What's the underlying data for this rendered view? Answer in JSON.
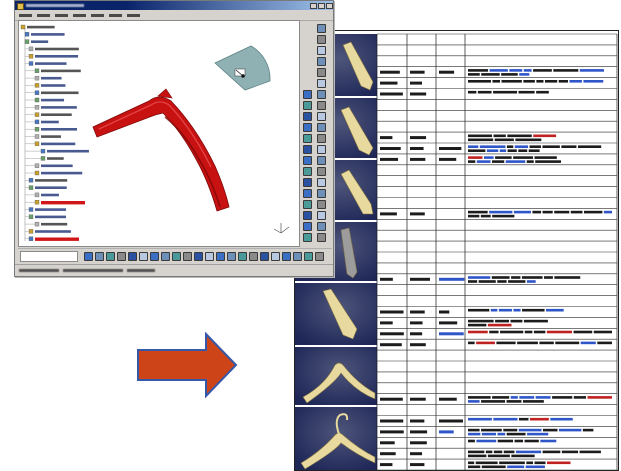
{
  "colors": {
    "arrow_fill": "#cc4418",
    "arrow_border": "#3658a8",
    "model_red": "#c81212",
    "model_red_dark": "#7e0808",
    "compass_teal": "#8fb1b3",
    "part_beige": "#e8da9e",
    "part_gray": "#9c9c9c",
    "thumb_bg": "#1d2656",
    "title_bar": "#0a246a",
    "window_face": "#d6d3ce"
  },
  "icons": {
    "window_controls": [
      "minimize-icon",
      "maximize-icon",
      "close-icon"
    ],
    "compass": "compass-icon",
    "axis": "axis-triad-icon",
    "process_arrow": "right-arrow-icon"
  }
}
